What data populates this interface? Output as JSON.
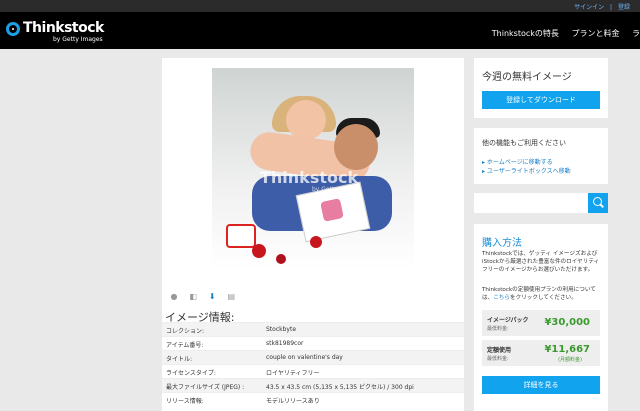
{
  "top_links": {
    "signin": "サインイン",
    "register": "登録"
  },
  "header": {
    "brand": "Thinkstock",
    "sub": "by Getty Images",
    "nav": [
      "Thinkstockの特長",
      "プランと料金",
      "ラ"
    ]
  },
  "image": {
    "watermark": "Thinkstock",
    "watermark_sub": "by Getty Images"
  },
  "image_info": {
    "title": "イメージ情報:",
    "rows": [
      {
        "k": "コレクション:",
        "v": "Stockbyte"
      },
      {
        "k": "アイテム番号:",
        "v": "stk81989cor"
      },
      {
        "k": "タイトル:",
        "v": "couple on valentine's day"
      },
      {
        "k": "ライセンスタイプ:",
        "v": "ロイヤリティフリー"
      },
      {
        "k": "最大ファイルサイズ (JPEG) :",
        "v": "43.5 x 43.5 cm (5,135 x 5,135 ピクセル) / 300 dpi"
      },
      {
        "k": "リリース情報:",
        "v": "モデルリリースあり"
      }
    ]
  },
  "weekly_free": {
    "title": "今週の無料イメージ",
    "button": "登録してダウンロード"
  },
  "other_features": {
    "title": "他の機能もご利用ください",
    "link1": "ホームページに移動する",
    "link2": "ユーザーライトボックスへ移動"
  },
  "search": {
    "placeholder": ""
  },
  "purchase": {
    "title": "購入方法",
    "text1": "Thinkstockでは、ゲッティ イメージズおよびiStockから厳選された豊富な件のロイヤリティフリーのイメージからお選びいただけます。",
    "text2_prefix": "Thinkstockの定額使用プランの利用については、",
    "text2_link": "こちら",
    "text2_suffix": "をクリックしてください。",
    "pack": {
      "label": "イメージパック",
      "sub": "最低料金:",
      "price": "¥30,000"
    },
    "sub": {
      "label": "定額使用",
      "sub": "最低料金:",
      "price": "¥11,667",
      "price_sub": "(月額料金)"
    },
    "button": "詳細を見る"
  },
  "colors": {
    "accent": "#11a3ed",
    "price": "#3a9a2e"
  }
}
